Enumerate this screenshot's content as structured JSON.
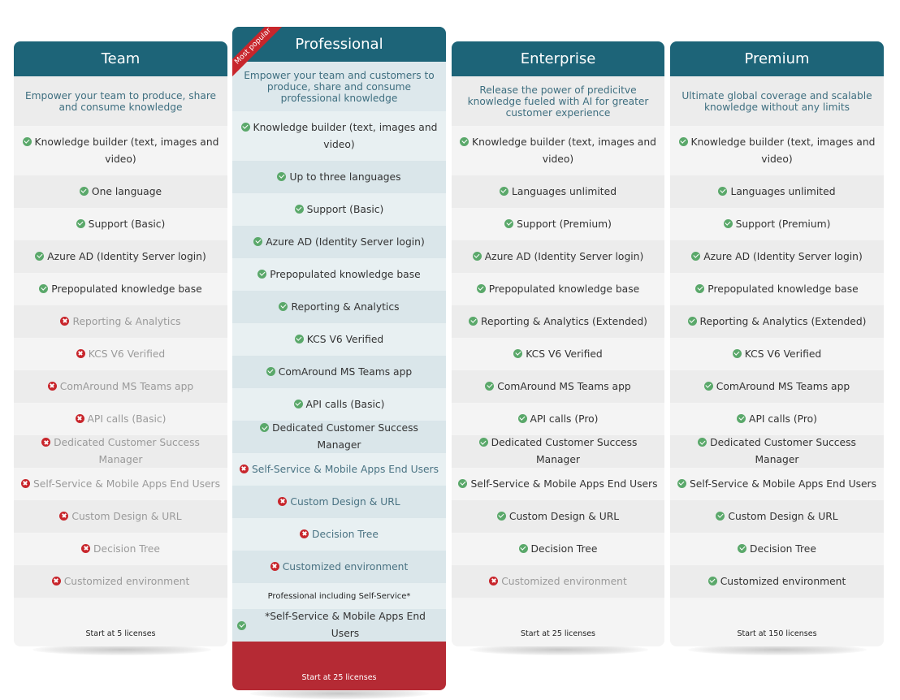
{
  "colors": {
    "header": "#1d6478",
    "accent_red": "#b52a34",
    "check_green": "#5aa86a",
    "cross_red": "#c8262c"
  },
  "plans": [
    {
      "name": "Team",
      "description": "Empower your team to produce, share and consume knowledge",
      "features": [
        {
          "label": "Knowledge builder (text, images and video)",
          "included": true
        },
        {
          "label": "One language",
          "included": true
        },
        {
          "label": "Support (Basic)",
          "included": true
        },
        {
          "label": "Azure AD (Identity Server login)",
          "included": true
        },
        {
          "label": "Prepopulated knowledge base",
          "included": true
        },
        {
          "label": "Reporting & Analytics",
          "included": false
        },
        {
          "label": "KCS V6 Verified",
          "included": false
        },
        {
          "label": "ComAround MS Teams app",
          "included": false
        },
        {
          "label": "API calls (Basic)",
          "included": false
        },
        {
          "label": "Dedicated Customer Success Manager",
          "included": false
        },
        {
          "label": "Self-Service & Mobile Apps End Users",
          "included": false
        },
        {
          "label": "Custom Design & URL",
          "included": false
        },
        {
          "label": "Decision Tree",
          "included": false
        },
        {
          "label": "Customized environment",
          "included": false
        }
      ],
      "footer": "Start at 5 licenses"
    },
    {
      "name": "Professional",
      "badge": "Most popular",
      "description": "Empower your team and customers to produce, share and consume professional knowledge",
      "features": [
        {
          "label": "Knowledge builder (text, images and video)",
          "included": true
        },
        {
          "label": "Up to three languages",
          "included": true
        },
        {
          "label": "Support (Basic)",
          "included": true
        },
        {
          "label": "Azure AD (Identity Server login)",
          "included": true
        },
        {
          "label": "Prepopulated knowledge base",
          "included": true
        },
        {
          "label": "Reporting & Analytics",
          "included": true
        },
        {
          "label": "KCS V6 Verified",
          "included": true
        },
        {
          "label": "ComAround MS Teams app",
          "included": true
        },
        {
          "label": "API calls (Basic)",
          "included": true
        },
        {
          "label": "Dedicated Customer Success Manager",
          "included": true
        },
        {
          "label": "Self-Service & Mobile Apps End Users",
          "included": false
        },
        {
          "label": "Custom Design & URL",
          "included": false
        },
        {
          "label": "Decision Tree",
          "included": false
        },
        {
          "label": "Customized environment",
          "included": false
        }
      ],
      "addon_note": "Professional including Self-Service*",
      "addon_feature": {
        "label": "*Self-Service & Mobile Apps End Users",
        "included": true
      },
      "footer": "Start at 25 licenses"
    },
    {
      "name": "Enterprise",
      "description": "Release the power of predicitve knowledge fueled with AI for greater customer experience",
      "features": [
        {
          "label": "Knowledge builder (text, images and video)",
          "included": true
        },
        {
          "label": "Languages unlimited",
          "included": true
        },
        {
          "label": "Support (Premium)",
          "included": true
        },
        {
          "label": "Azure AD (Identity Server login)",
          "included": true
        },
        {
          "label": "Prepopulated knowledge base",
          "included": true
        },
        {
          "label": "Reporting & Analytics (Extended)",
          "included": true
        },
        {
          "label": "KCS V6 Verified",
          "included": true
        },
        {
          "label": "ComAround MS Teams app",
          "included": true
        },
        {
          "label": "API calls (Pro)",
          "included": true
        },
        {
          "label": "Dedicated Customer Success Manager",
          "included": true
        },
        {
          "label": "Self-Service & Mobile Apps End Users",
          "included": true
        },
        {
          "label": "Custom Design & URL",
          "included": true
        },
        {
          "label": "Decision Tree",
          "included": true
        },
        {
          "label": "Customized environment",
          "included": false
        }
      ],
      "footer": "Start at 25 licenses"
    },
    {
      "name": "Premium",
      "description": "Ultimate global coverage and scalable knowledge without any limits",
      "features": [
        {
          "label": "Knowledge builder (text, images and video)",
          "included": true
        },
        {
          "label": "Languages unlimited",
          "included": true
        },
        {
          "label": "Support (Premium)",
          "included": true
        },
        {
          "label": "Azure AD (Identity Server login)",
          "included": true
        },
        {
          "label": "Prepopulated knowledge base",
          "included": true
        },
        {
          "label": "Reporting & Analytics (Extended)",
          "included": true
        },
        {
          "label": "KCS V6 Verified",
          "included": true
        },
        {
          "label": "ComAround MS Teams app",
          "included": true
        },
        {
          "label": "API calls (Pro)",
          "included": true
        },
        {
          "label": "Dedicated Customer Success Manager",
          "included": true
        },
        {
          "label": "Self-Service & Mobile Apps End Users",
          "included": true
        },
        {
          "label": "Custom Design & URL",
          "included": true
        },
        {
          "label": "Decision Tree",
          "included": true
        },
        {
          "label": "Customized environment",
          "included": true
        }
      ],
      "footer": "Start at 150 licenses"
    }
  ]
}
